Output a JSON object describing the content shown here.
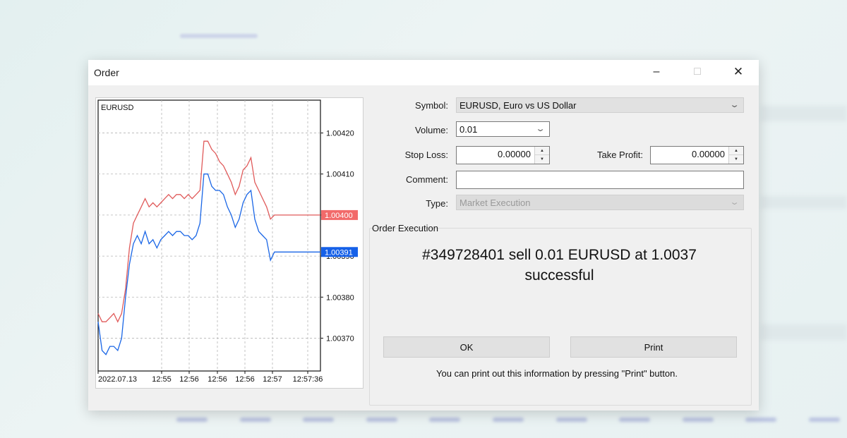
{
  "window": {
    "title": "Order",
    "minimize_glyph": "–",
    "maximize_glyph": "□",
    "close_glyph": "✕"
  },
  "chart": {
    "symbol": "EURUSD",
    "y_ticks": [
      "1.00420",
      "1.00410",
      "1.00400",
      "1.00390",
      "1.00380",
      "1.00370"
    ],
    "x_ticks": [
      "2022.07.13",
      "12:55",
      "12:56",
      "12:56",
      "12:56",
      "12:57",
      "12:57:36"
    ],
    "ask_label": "1.00400",
    "bid_label": "1.00391",
    "colors": {
      "ask": "#e05a5a",
      "bid": "#1a66e6",
      "ask_badge": "#f26a6a",
      "bid_badge": "#1560e8"
    }
  },
  "form": {
    "symbol_label": "Symbol:",
    "symbol_value": "EURUSD, Euro vs US Dollar",
    "volume_label": "Volume:",
    "volume_value": "0.01",
    "stop_loss_label": "Stop Loss:",
    "stop_loss_value": "0.00000",
    "take_profit_label": "Take Profit:",
    "take_profit_value": "0.00000",
    "comment_label": "Comment:",
    "comment_value": "",
    "type_label": "Type:",
    "type_value": "Market Execution"
  },
  "execution": {
    "group_label": "Order Execution",
    "line1": "#349728401 sell 0.01 EURUSD at 1.0037",
    "line2": "successful",
    "ok_label": "OK",
    "print_label": "Print",
    "hint": "You can print out this information by pressing \"Print\" button."
  },
  "chart_data": {
    "type": "line",
    "title": "EURUSD",
    "ylim": [
      1.00362,
      1.00428
    ],
    "series": [
      {
        "name": "",
        "color": "#e05a5a",
        "values": [
          1.00376,
          1.00374,
          1.00374,
          1.00375,
          1.00376,
          1.00374,
          1.00376,
          1.00382,
          1.00392,
          1.00398,
          1.004,
          1.00402,
          1.00404,
          1.00402,
          1.00403,
          1.00402,
          1.00403,
          1.00404,
          1.00405,
          1.00404,
          1.00405,
          1.00405,
          1.00404,
          1.00405,
          1.00404,
          1.00405,
          1.00406,
          1.00418,
          1.00418,
          1.00416,
          1.00415,
          1.00413,
          1.00412,
          1.0041,
          1.00408,
          1.00405,
          1.00407,
          1.00411,
          1.00412,
          1.00414,
          1.00408,
          1.00406,
          1.00404,
          1.00402,
          1.00399,
          1.004,
          1.004,
          1.004,
          1.004,
          1.004
        ]
      },
      {
        "name": "",
        "color": "#1a66e6",
        "values": [
          1.00374,
          1.00367,
          1.00366,
          1.00368,
          1.00368,
          1.00367,
          1.0037,
          1.0038,
          1.00388,
          1.00393,
          1.00395,
          1.00393,
          1.00396,
          1.00393,
          1.00394,
          1.00392,
          1.00394,
          1.00395,
          1.00396,
          1.00395,
          1.00396,
          1.00396,
          1.00395,
          1.00395,
          1.00394,
          1.00395,
          1.00398,
          1.0041,
          1.0041,
          1.00407,
          1.00406,
          1.00406,
          1.00405,
          1.00402,
          1.004,
          1.00397,
          1.00399,
          1.00403,
          1.00405,
          1.00406,
          1.00399,
          1.00396,
          1.00395,
          1.00394,
          1.00389,
          1.00391,
          1.00391,
          1.00391,
          1.00391,
          1.00391
        ]
      }
    ]
  }
}
